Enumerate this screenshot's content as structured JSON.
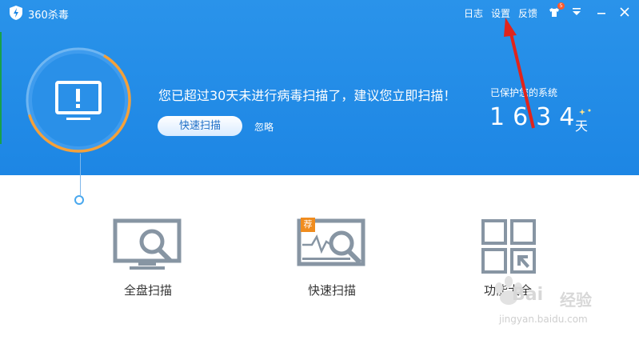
{
  "titlebar": {
    "app_title": "360杀毒",
    "log_label": "日志",
    "settings_label": "设置",
    "feedback_label": "反馈",
    "skin_badge": "5"
  },
  "status": {
    "warning": "您已超过30天未进行病毒扫描了，建议您立即扫描！",
    "quick_scan_button": "快速扫描",
    "ignore_link": "忽略",
    "protected_label": "已保护您的系统",
    "protected_days": "1634",
    "days_unit": "天",
    "ring_progress": 0.62
  },
  "tools": [
    {
      "label": "全盘扫描"
    },
    {
      "label": "快速扫描",
      "tag": "荐"
    },
    {
      "label": "功能大全"
    }
  ],
  "watermark": {
    "brand": "Bai",
    "brand_cn": "经验",
    "url": "jingyan.baidu.com"
  },
  "colors": {
    "header_blue": "#2a93ea",
    "ring_orange": "#f4a13a",
    "arrow_red": "#e0241c",
    "icon_gray": "#8795a3"
  }
}
